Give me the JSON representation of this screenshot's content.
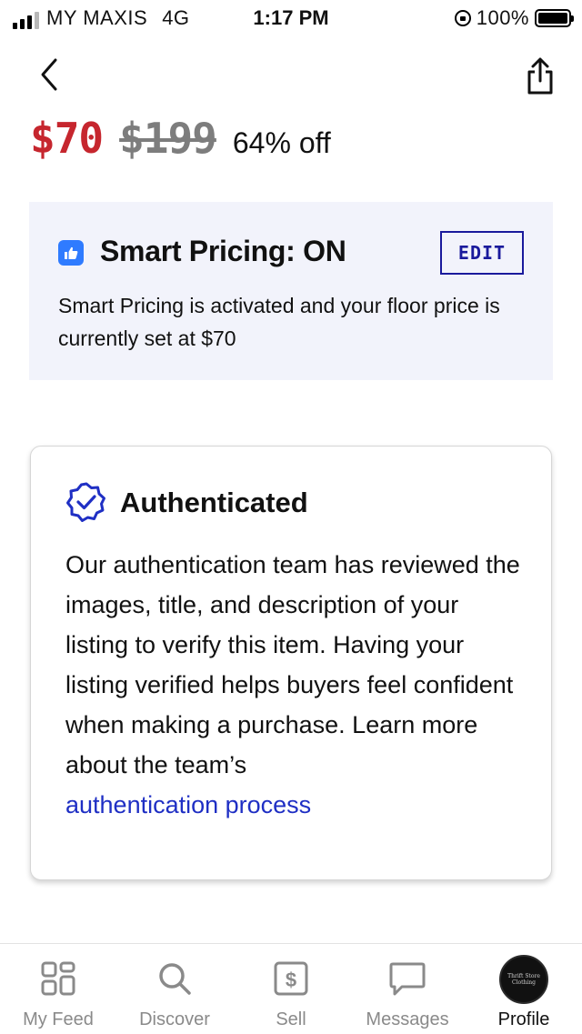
{
  "status_bar": {
    "carrier": "MY MAXIS",
    "network": "4G",
    "time": "1:17 PM",
    "battery": "100%"
  },
  "nav": {
    "back_icon": "chevron-left-icon",
    "share_icon": "share-icon"
  },
  "price": {
    "current": "$70",
    "original": "$199",
    "discount": "64% off",
    "current_color": "#c6262e"
  },
  "smart_pricing": {
    "icon": "thumbs-up-icon",
    "title": "Smart Pricing: ON",
    "edit_label": "EDIT",
    "description": "Smart Pricing is activated and your floor price is currently set at $70",
    "background": "#f2f3fb"
  },
  "authenticated": {
    "icon": "verified-badge-icon",
    "title": "Authenticated",
    "body": "Our authentication team has reviewed the images, title, and description of your listing to verify this item. Having your listing verified helps buyers feel confident when making a purchase. Learn more about the team’s",
    "link": "authentication process",
    "link_color": "#1f2fc4"
  },
  "tab_bar": {
    "tabs": [
      {
        "label": "My Feed",
        "icon": "feed-grid-icon"
      },
      {
        "label": "Discover",
        "icon": "search-icon"
      },
      {
        "label": "Sell",
        "icon": "dollar-icon"
      },
      {
        "label": "Messages",
        "icon": "message-bubble-icon"
      },
      {
        "label": "Profile",
        "icon": "avatar",
        "active": true
      }
    ],
    "avatar_text": [
      "Thrift Store",
      "Clothing"
    ]
  }
}
